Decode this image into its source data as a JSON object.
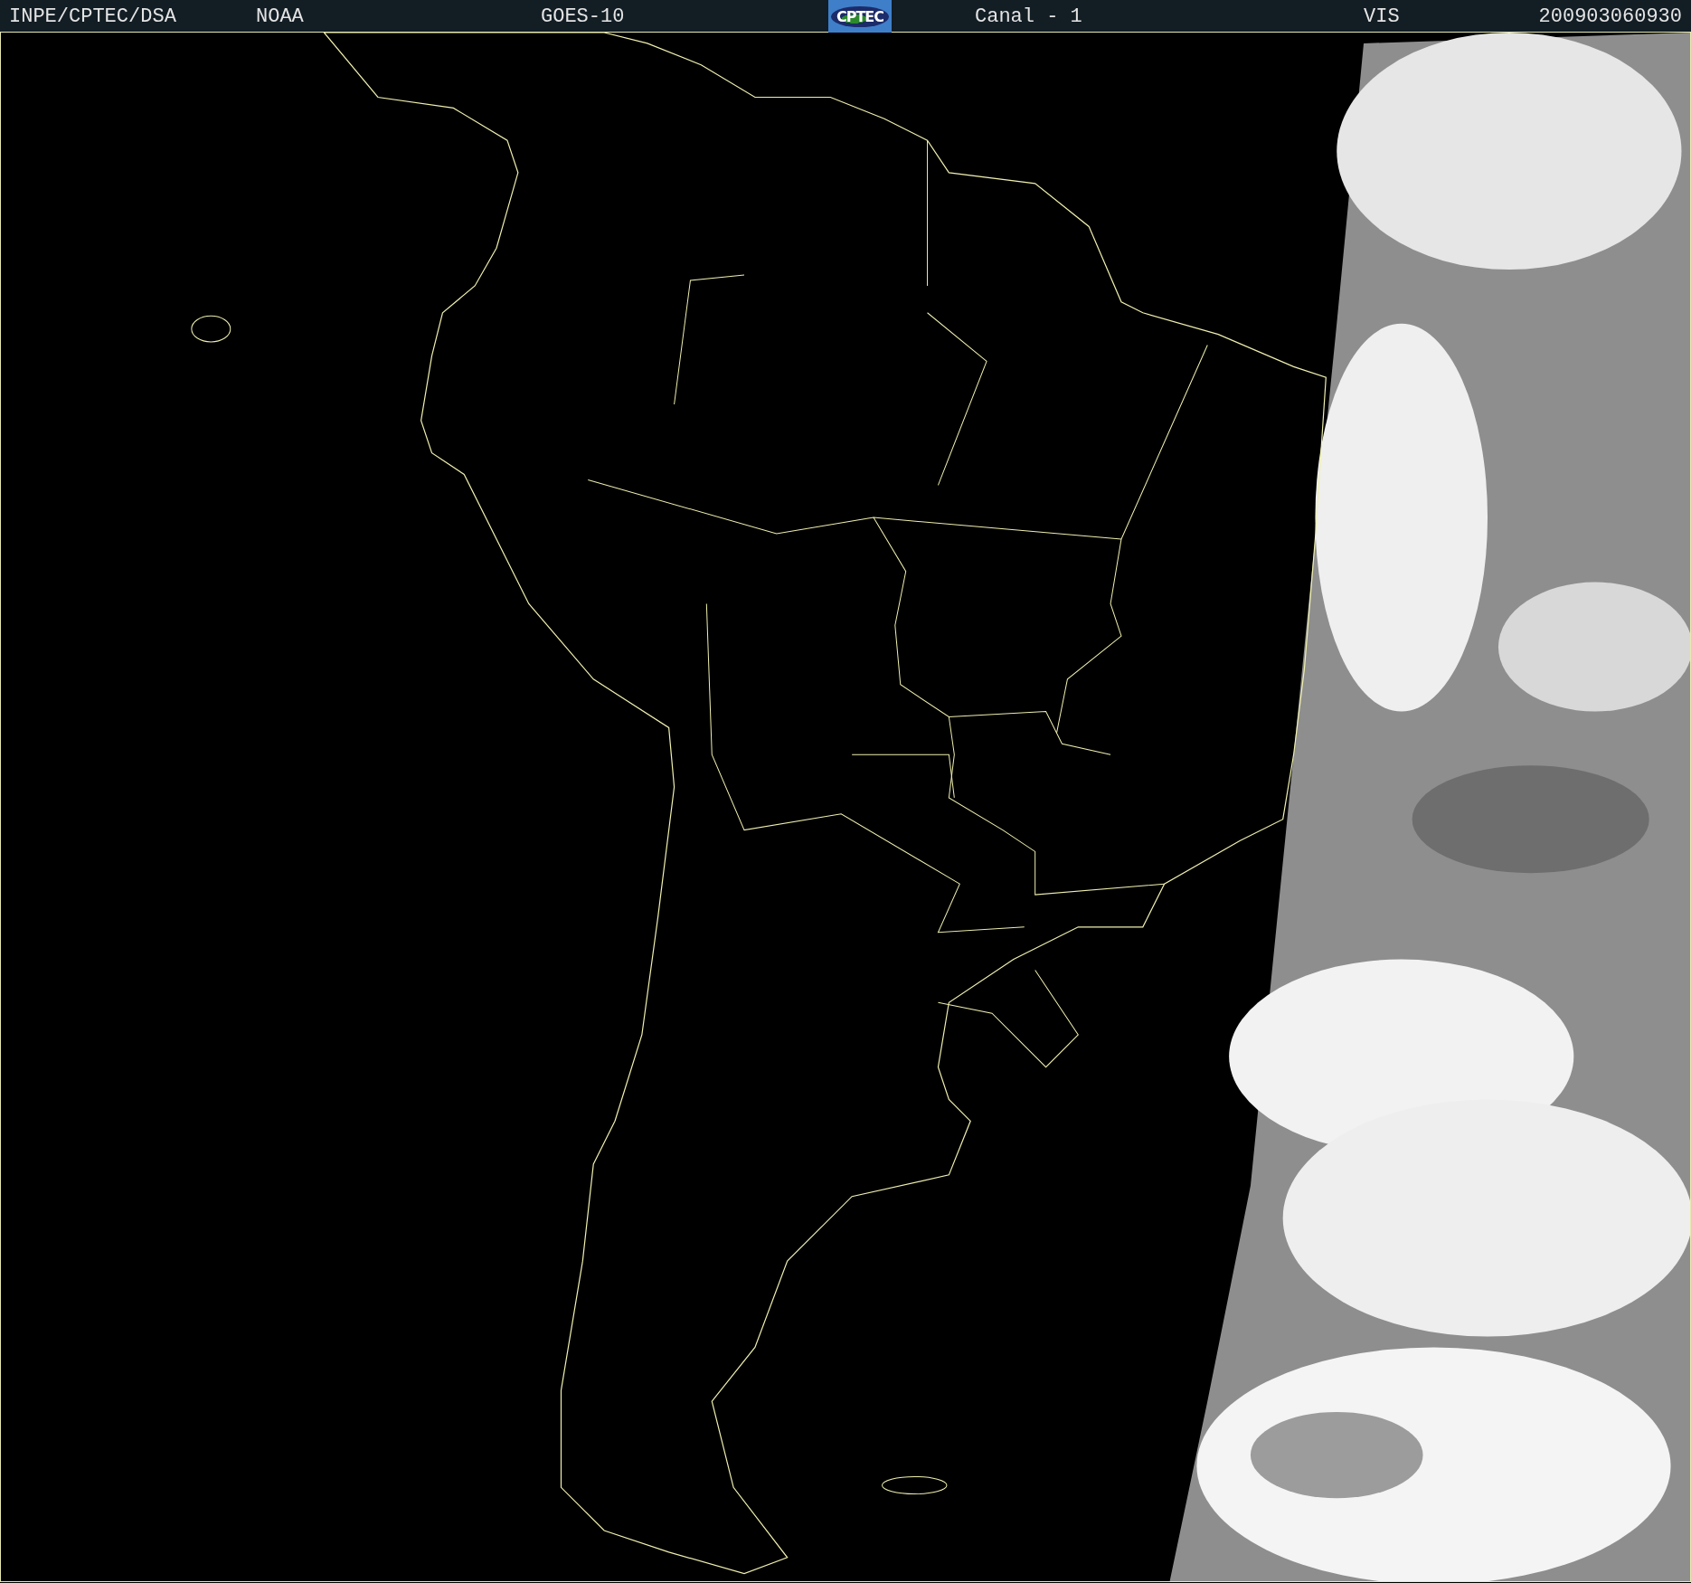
{
  "header": {
    "items": [
      {
        "kind": "text",
        "text": "INPE/CPTEC/DSA"
      },
      {
        "kind": "text",
        "text": "NOAA"
      },
      {
        "kind": "text",
        "text": "GOES-10"
      },
      {
        "kind": "logo",
        "text": "CPTEC"
      },
      {
        "kind": "text",
        "text": "Canal - 1"
      },
      {
        "kind": "text",
        "text": "VIS"
      },
      {
        "kind": "text",
        "text": "200903060930"
      }
    ]
  }
}
